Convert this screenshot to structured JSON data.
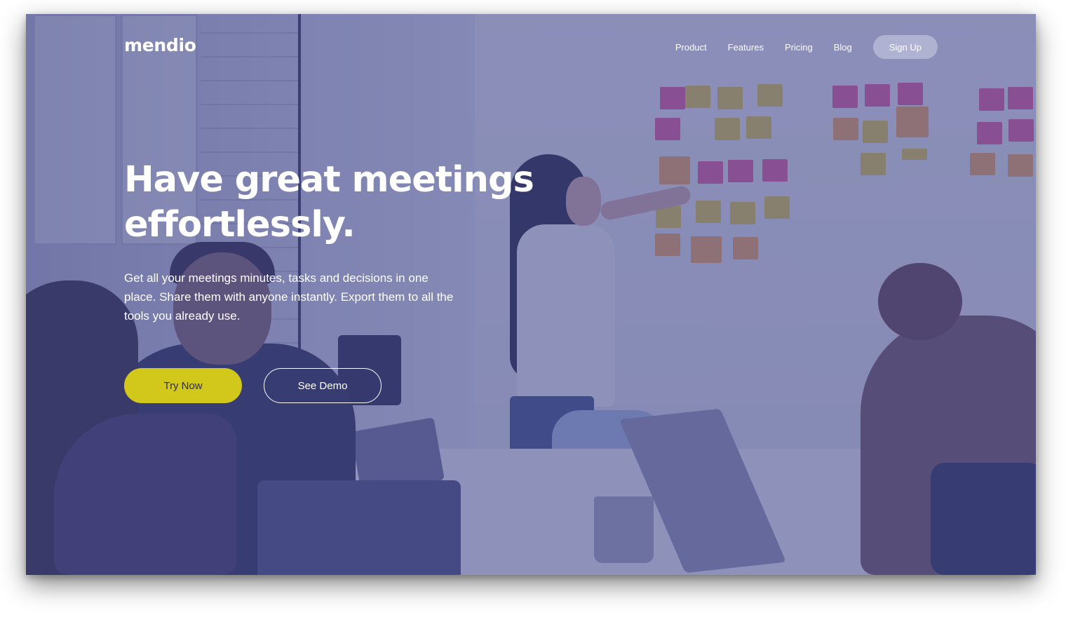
{
  "brand": {
    "name": "mendio"
  },
  "nav": {
    "links": [
      "Product",
      "Features",
      "Pricing",
      "Blog"
    ],
    "signup_label": "Sign Up"
  },
  "hero": {
    "headline": "Have great meetings effortlessly.",
    "subtext": "Get all your meetings minutes, tasks and decisions in one place. Share them with anyone instantly. Export them to all the tools you already use.",
    "primary_cta": "Try Now",
    "secondary_cta": "See Demo"
  },
  "colors": {
    "overlay": "#464a8c",
    "accent": "#d2c81c",
    "text": "#ffffff"
  }
}
